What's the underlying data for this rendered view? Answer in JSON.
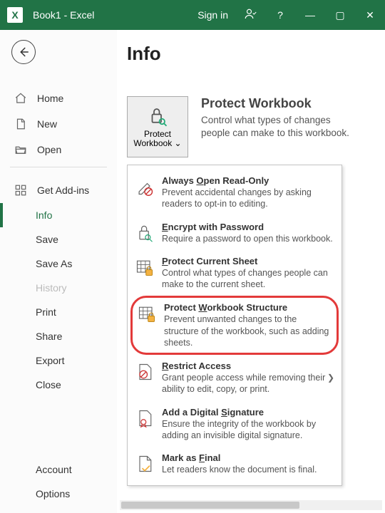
{
  "titlebar": {
    "app_title": "Book1 - Excel",
    "signin": "Sign in"
  },
  "sidebar": {
    "home": "Home",
    "new": "New",
    "open": "Open",
    "get_addins": "Get Add-ins",
    "info": "Info",
    "save": "Save",
    "save_as": "Save As",
    "history": "History",
    "print": "Print",
    "share": "Share",
    "export": "Export",
    "close": "Close",
    "account": "Account",
    "options": "Options"
  },
  "main": {
    "page_title": "Info",
    "protect_tile": "Protect Workbook ⌄",
    "section_title": "Protect Workbook",
    "section_text": "Control what types of changes people can make to this workbook."
  },
  "menu": [
    {
      "title_pre": "Always ",
      "title_ul": "O",
      "title_post": "pen Read-Only",
      "desc": "Prevent accidental changes by asking readers to opt-in to editing."
    },
    {
      "title_pre": "",
      "title_ul": "E",
      "title_post": "ncrypt with Password",
      "desc": "Require a password to open this workbook."
    },
    {
      "title_pre": "",
      "title_ul": "P",
      "title_post": "rotect Current Sheet",
      "desc": "Control what types of changes people can make to the current sheet."
    },
    {
      "title_pre": "Protect ",
      "title_ul": "W",
      "title_post": "orkbook Structure",
      "desc": "Prevent unwanted changes to the structure of the workbook, such as adding sheets."
    },
    {
      "title_pre": "",
      "title_ul": "R",
      "title_post": "estrict Access",
      "desc": "Grant people access while removing their ability to edit, copy, or print.",
      "has_submenu": true
    },
    {
      "title_pre": "Add a Digital ",
      "title_ul": "S",
      "title_post": "ignature",
      "desc": "Ensure the integrity of the workbook by adding an invisible digital signature."
    },
    {
      "title_pre": "Mark as ",
      "title_ul": "F",
      "title_post": "inal",
      "desc": "Let readers know the document is final."
    }
  ]
}
